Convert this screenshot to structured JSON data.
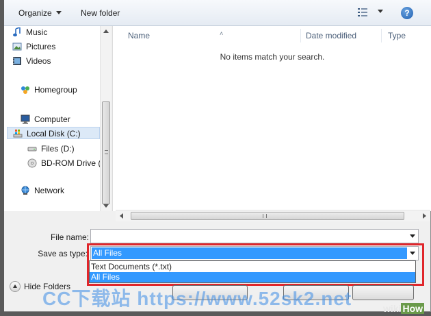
{
  "toolbar": {
    "organize_label": "Organize",
    "new_folder_label": "New folder",
    "help_label": "?"
  },
  "nav": {
    "items": [
      {
        "label": "Music",
        "icon": "music-icon"
      },
      {
        "label": "Pictures",
        "icon": "pictures-icon"
      },
      {
        "label": "Videos",
        "icon": "videos-icon"
      },
      {
        "label": "Homegroup",
        "icon": "homegroup-icon"
      },
      {
        "label": "Computer",
        "icon": "computer-icon"
      },
      {
        "label": "Local Disk (C:)",
        "icon": "local-disk-icon",
        "selected": true
      },
      {
        "label": "Files (D:)",
        "icon": "drive-icon"
      },
      {
        "label": "BD-ROM Drive (",
        "icon": "disc-icon"
      },
      {
        "label": "Network",
        "icon": "network-icon"
      }
    ]
  },
  "columns": {
    "name": "Name",
    "date_modified": "Date modified",
    "type": "Type"
  },
  "main": {
    "empty_message": "No items match your search."
  },
  "form": {
    "file_name_label": "File name:",
    "file_name_value": "",
    "save_as_type_label": "Save as type:",
    "save_as_type_value": "All Files",
    "type_options": [
      "Text Documents (*.txt)",
      "All Files"
    ],
    "highlighted_option": "All Files"
  },
  "footer": {
    "hide_folders_label": "Hide Folders"
  },
  "overlays": {
    "watermark_text": "CC下载站 https://www.52sk2.net",
    "brand_wiki": "wiki",
    "brand_how": "How"
  },
  "colors": {
    "highlight": "#3399ff",
    "annotation_box": "#e0262b"
  }
}
